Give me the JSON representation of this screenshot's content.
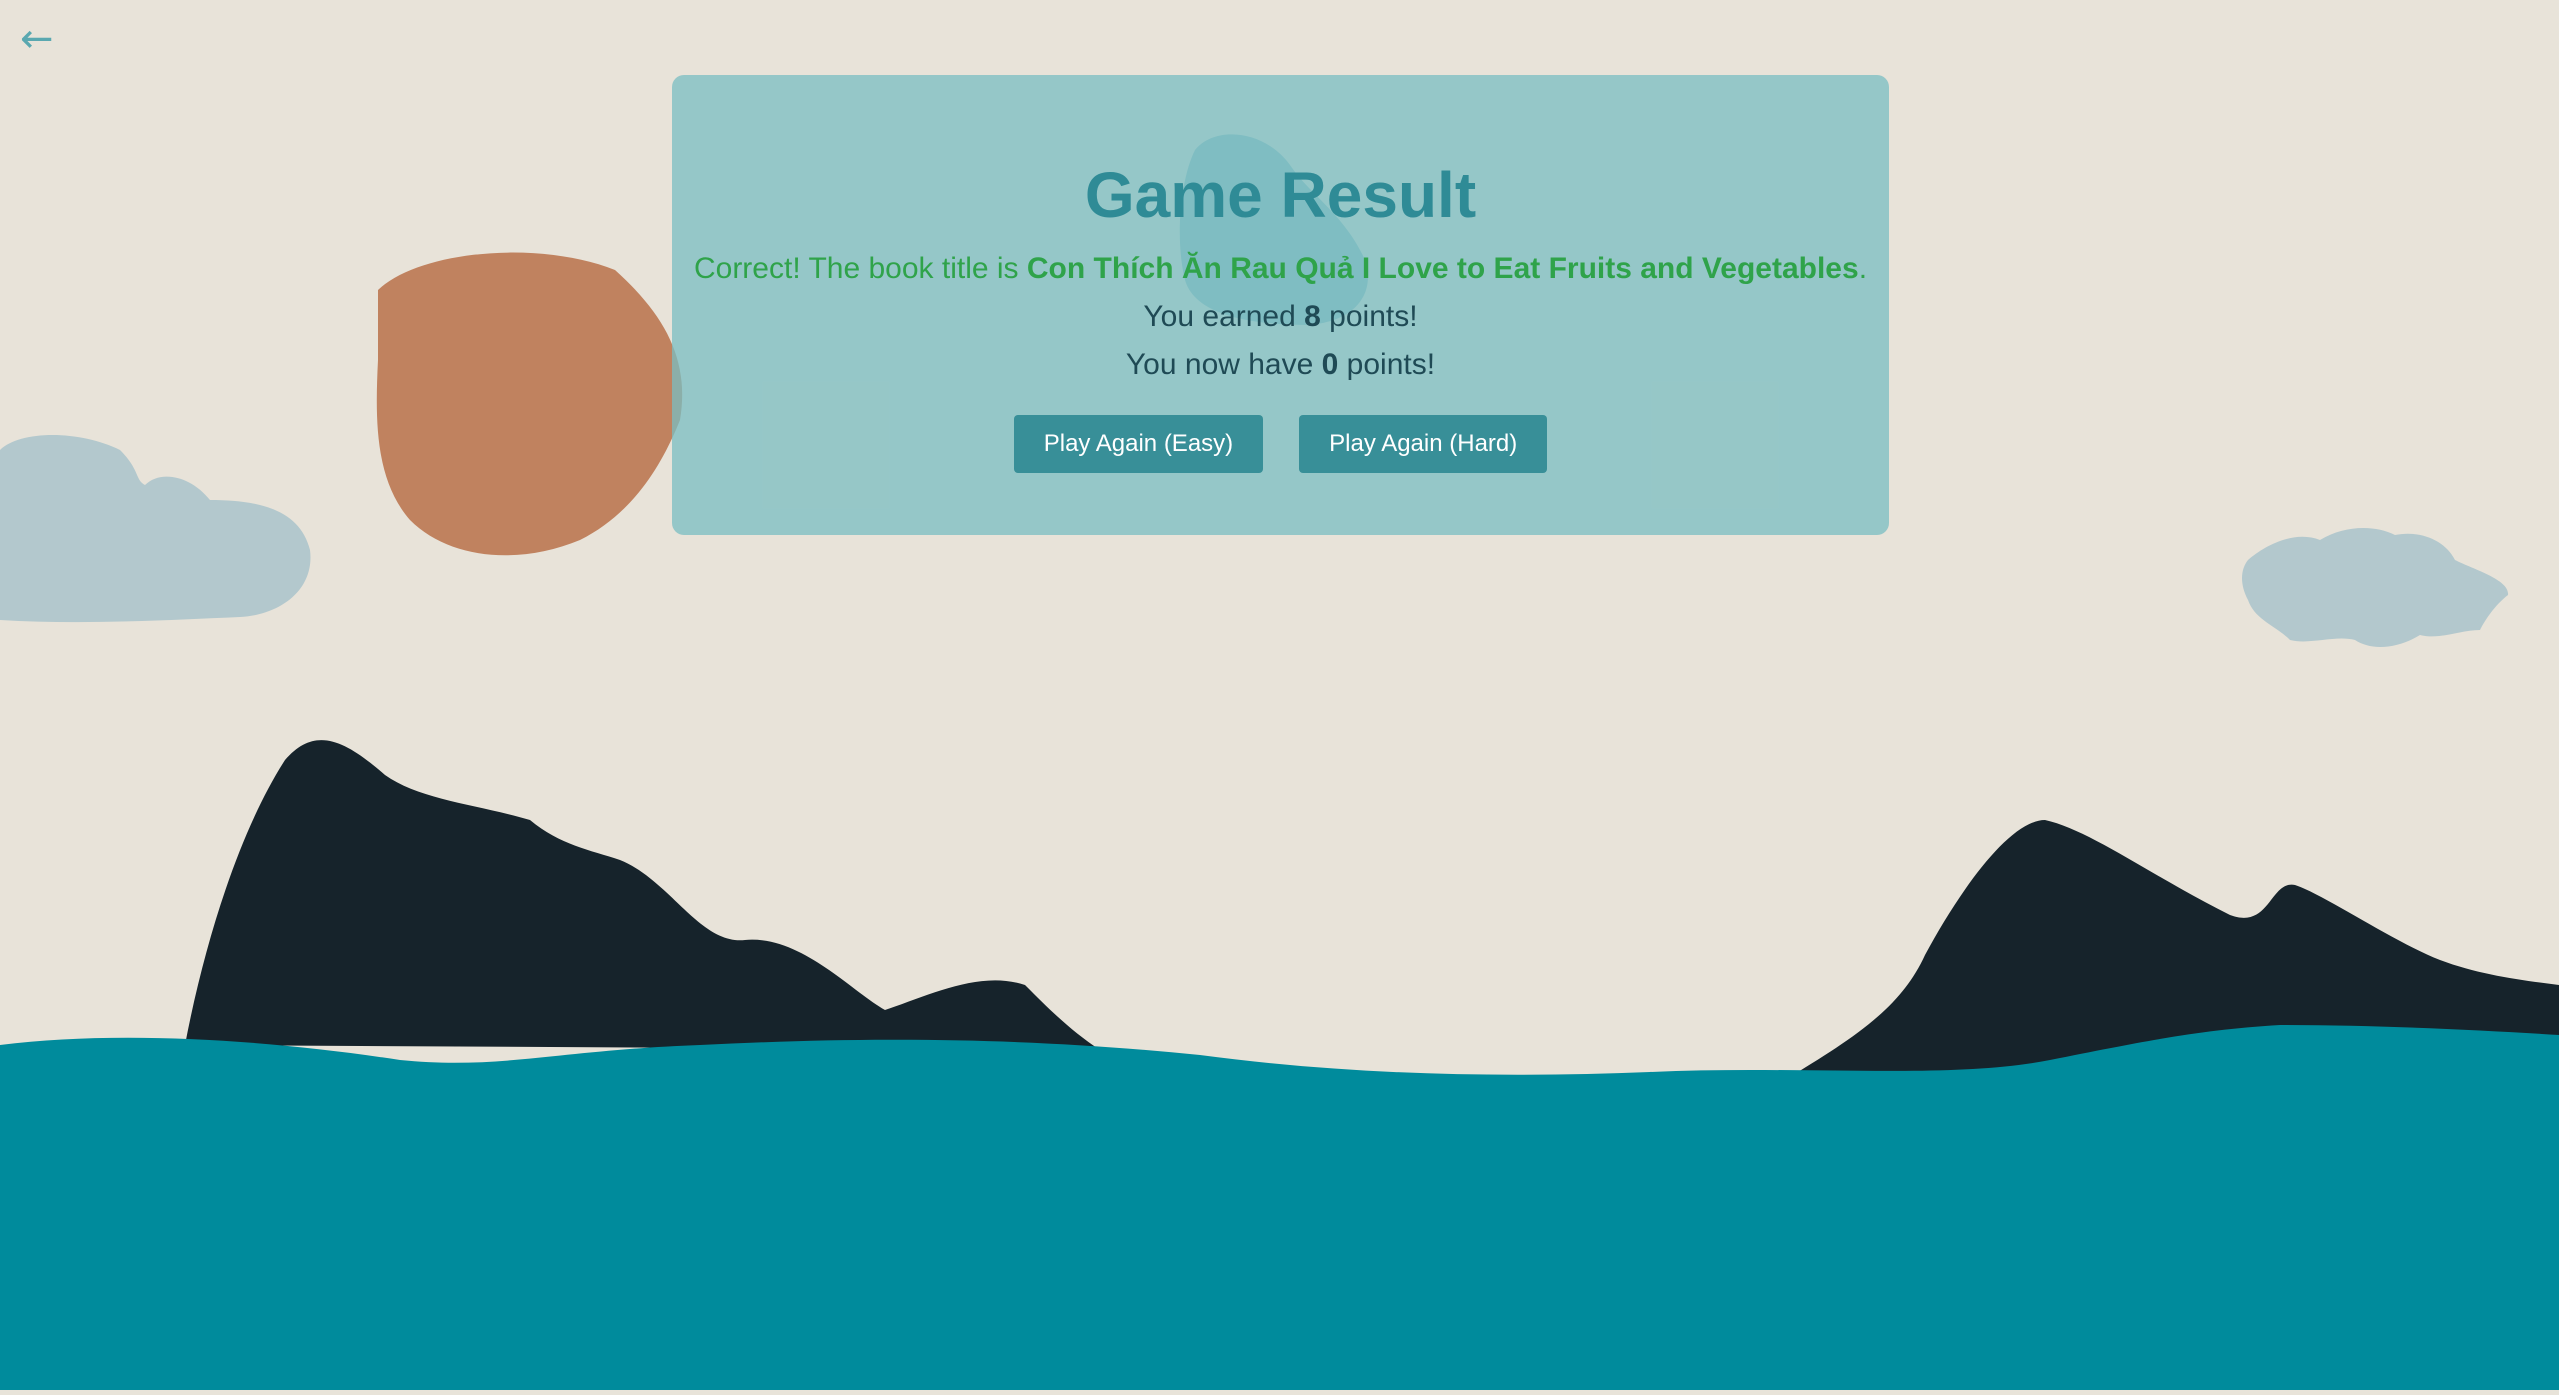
{
  "nav": {
    "back_glyph": "←",
    "back_icon": "back-arrow-icon"
  },
  "result": {
    "title": "Game Result",
    "correct_prefix": "Correct! The book title is ",
    "book_title": "Con Thích Ăn Rau Quả I Love to Eat Fruits and Vegetables",
    "correct_suffix": ".",
    "earned_prefix": "You earned ",
    "earned_points": "8",
    "earned_suffix": " points!",
    "total_prefix": "You now have ",
    "total_points": "0",
    "total_suffix": " points!"
  },
  "buttons": {
    "easy_label": "Play Again (Easy)",
    "hard_label": "Play Again (Hard)"
  },
  "colors": {
    "background": "#e8e3d9",
    "panel": "#7abec1",
    "title": "#2f8b96",
    "success_text": "#2fa34a",
    "body_text": "#1f4a55",
    "button": "#388f98",
    "sun": "#c0825f",
    "cloud": "#b3c8cd",
    "mountains": "#16232b",
    "sea": "#008b9c"
  }
}
